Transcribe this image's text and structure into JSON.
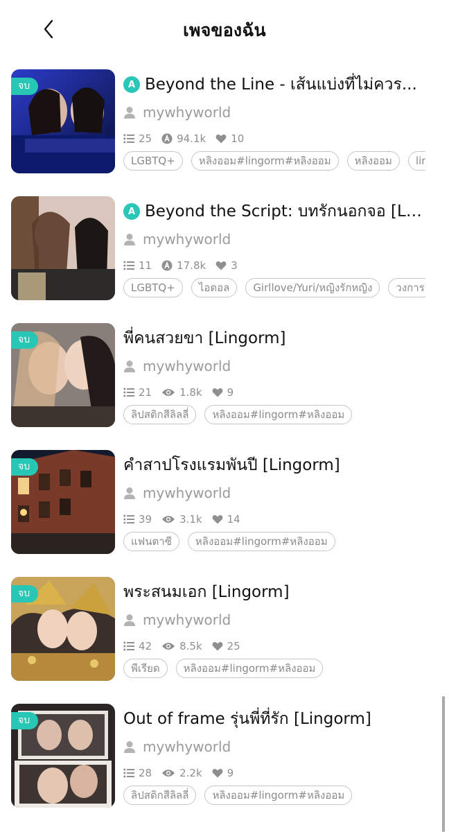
{
  "header": {
    "title": "เพจของฉัน"
  },
  "items": [
    {
      "badge": "จบ",
      "has_a_icon": true,
      "a_icon": "A",
      "title": "Beyond the Line - เส้นแบ่งที่ไม่ควร...",
      "author": "mywhyworld",
      "chapters": "25",
      "views_icon": "a-circle-icon",
      "views": "94.1k",
      "likes": "10",
      "tags": [
        "LGBTQ+",
        "หลิงออม#lingorm#หลิงออม",
        "หลิงออม",
        "lin"
      ]
    },
    {
      "badge": "",
      "has_a_icon": true,
      "a_icon": "A",
      "title": "Beyond the Script: บทรักนอกจอ [Li...",
      "author": "mywhyworld",
      "chapters": "11",
      "views_icon": "a-circle-icon",
      "views": "17.8k",
      "likes": "3",
      "tags": [
        "LGBTQ+",
        "ไอดอล",
        "Girllove/Yuri/หญิงรักหญิง",
        "วงการ"
      ]
    },
    {
      "badge": "จบ",
      "has_a_icon": false,
      "title": "พี่คนสวยขา [Lingorm]",
      "author": "mywhyworld",
      "chapters": "21",
      "views_icon": "eye-icon",
      "views": "1.8k",
      "likes": "9",
      "tags": [
        "ลิปสติกสีลิลลี่",
        "หลิงออม#lingorm#หลิงออม"
      ]
    },
    {
      "badge": "จบ",
      "has_a_icon": false,
      "title": "คำสาปโรงแรมพันปี [Lingorm]",
      "author": "mywhyworld",
      "chapters": "39",
      "views_icon": "eye-icon",
      "views": "3.1k",
      "likes": "14",
      "tags": [
        "แฟนตาซี",
        "หลิงออม#lingorm#หลิงออม"
      ]
    },
    {
      "badge": "จบ",
      "has_a_icon": false,
      "title": "พระสนมเอก [Lingorm]",
      "author": "mywhyworld",
      "chapters": "42",
      "views_icon": "eye-icon",
      "views": "8.5k",
      "likes": "25",
      "tags": [
        "พีเรียด",
        "หลิงออม#lingorm#หลิงออม"
      ]
    },
    {
      "badge": "จบ",
      "has_a_icon": false,
      "title": "Out of frame รุ่นพี่ที่รัก [Lingorm]",
      "author": "mywhyworld",
      "chapters": "28",
      "views_icon": "eye-icon",
      "views": "2.2k",
      "likes": "9",
      "tags": [
        "ลิปสติกสีลิลลี่",
        "หลิงออม#lingorm#หลิงออม"
      ]
    }
  ],
  "colors": {
    "accent": "#27c6b5",
    "muted_text": "#9a9a9a",
    "tag_border": "#c7c7c7"
  }
}
